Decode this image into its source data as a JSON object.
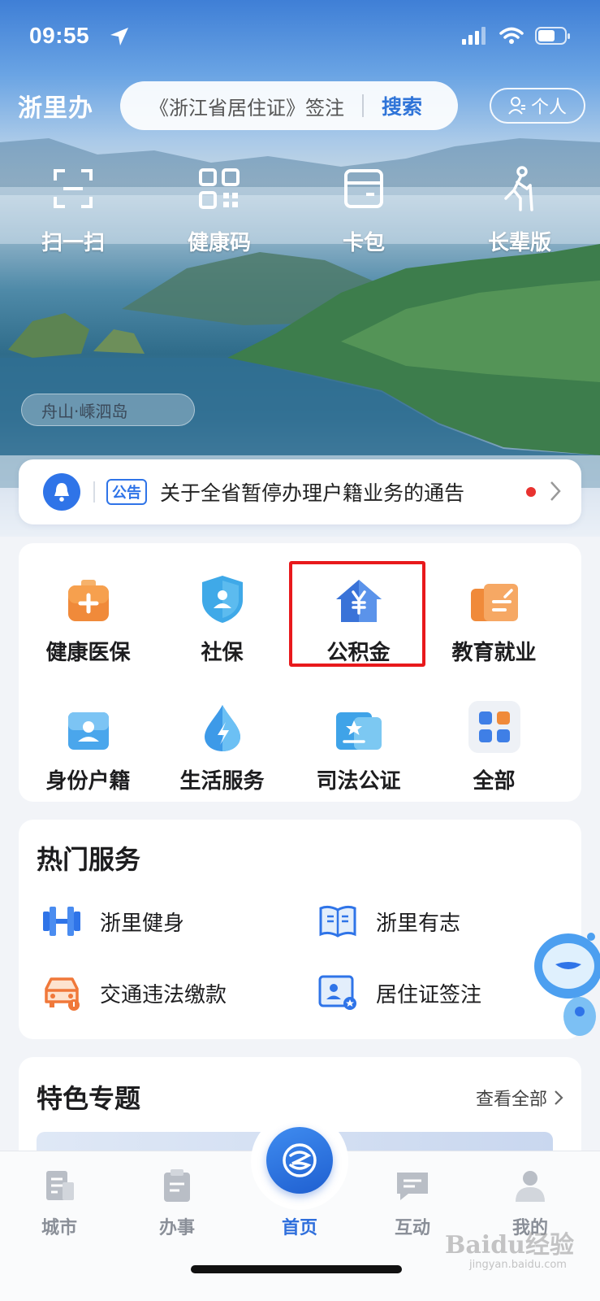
{
  "status": {
    "time": "09:55"
  },
  "header": {
    "logo": "浙里办",
    "search_text": "《浙江省居住证》签注",
    "search_button": "搜索",
    "personal_label": "个人"
  },
  "quick_actions": [
    {
      "label": "扫一扫",
      "icon": "scan-icon"
    },
    {
      "label": "健康码",
      "icon": "qr-code-icon"
    },
    {
      "label": "卡包",
      "icon": "card-wallet-icon"
    },
    {
      "label": "长辈版",
      "icon": "elder-icon"
    }
  ],
  "banner": {
    "location": "舟山·嵊泗岛"
  },
  "notice": {
    "tag": "公告",
    "text": "关于全省暂停办理户籍业务的通告"
  },
  "services": [
    {
      "label": "健康医保",
      "icon": "medical-kit-icon"
    },
    {
      "label": "社保",
      "icon": "shield-person-icon"
    },
    {
      "label": "公积金",
      "icon": "house-yuan-icon"
    },
    {
      "label": "教育就业",
      "icon": "education-icon"
    },
    {
      "label": "身份户籍",
      "icon": "id-card-icon"
    },
    {
      "label": "生活服务",
      "icon": "lightning-drop-icon"
    },
    {
      "label": "司法公证",
      "icon": "notary-icon"
    },
    {
      "label": "全部",
      "icon": "all-grid-icon"
    }
  ],
  "hot_services": {
    "title": "热门服务",
    "items": [
      {
        "label": "浙里健身",
        "icon": "dumbbell-icon"
      },
      {
        "label": "浙里有志",
        "icon": "book-icon"
      },
      {
        "label": "交通违法缴款",
        "icon": "car-icon"
      },
      {
        "label": "居住证签注",
        "icon": "residence-permit-icon"
      }
    ]
  },
  "featured": {
    "title": "特色专题",
    "view_all": "查看全部"
  },
  "tabs": [
    {
      "label": "城市",
      "active": false
    },
    {
      "label": "办事",
      "active": false
    },
    {
      "label": "首页",
      "active": true
    },
    {
      "label": "互动",
      "active": false
    },
    {
      "label": "我的",
      "active": false
    }
  ],
  "watermark": {
    "text": "Baidu经验",
    "sub": "jingyan.baidu.com"
  },
  "colors": {
    "accent": "#2f74e8",
    "highlight": "#e8191c",
    "notice_dot": "#e8322f"
  }
}
